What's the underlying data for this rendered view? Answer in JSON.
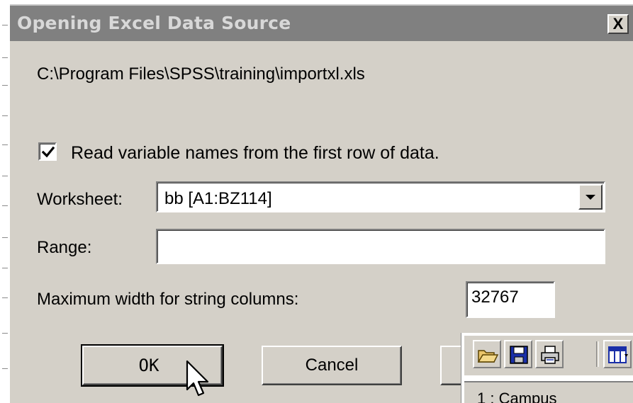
{
  "dialog": {
    "title": "Opening Excel Data Source",
    "close_label": "X",
    "file_path": "C:\\Program Files\\SPSS\\training\\importxl.xls",
    "read_names": {
      "label": "Read variable names from the first row of data.",
      "checked": true
    },
    "worksheet": {
      "label": "Worksheet:",
      "value": "bb  [A1:BZ114]"
    },
    "range": {
      "label": "Range:",
      "value": ""
    },
    "max_width": {
      "label": "Maximum width for string columns:",
      "value": "32767"
    },
    "buttons": {
      "ok": "OK",
      "cancel": "Cancel"
    }
  },
  "background_window": {
    "toolbar_icons": [
      "open-folder-icon",
      "save-disk-icon",
      "print-icon",
      "data-view-icon"
    ],
    "cell_text": "1 : Campus"
  }
}
